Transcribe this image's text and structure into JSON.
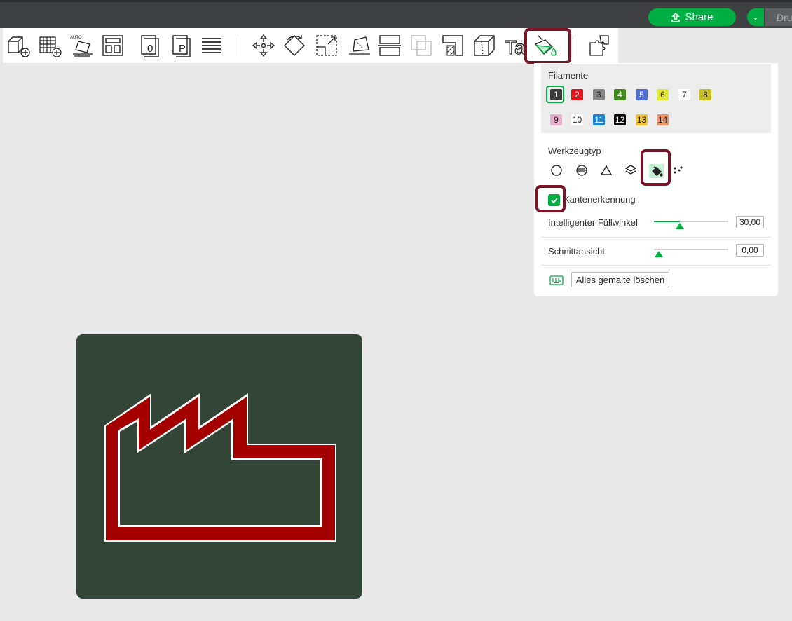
{
  "topbar": {
    "share_label": "Share",
    "print_label": "Dru"
  },
  "toolbar": {
    "tools": [
      {
        "name": "add-object-icon"
      },
      {
        "name": "add-plate-icon"
      },
      {
        "name": "auto-orient-icon",
        "label": "AUTO"
      },
      {
        "name": "arrange-icon"
      },
      {
        "name": "object-zero-icon",
        "label": "0"
      },
      {
        "name": "plate-p-icon",
        "label": "P"
      },
      {
        "name": "layers-list-icon"
      },
      {
        "name": "move-icon"
      },
      {
        "name": "rotate-icon"
      },
      {
        "name": "scale-icon"
      },
      {
        "name": "lay-on-face-icon"
      },
      {
        "name": "cut-icon"
      },
      {
        "name": "boolean-icon"
      },
      {
        "name": "support-paint-icon"
      },
      {
        "name": "seam-paint-icon"
      },
      {
        "name": "text-icon",
        "label": "Ta"
      },
      {
        "name": "color-paint-icon"
      },
      {
        "name": "assembly-icon"
      }
    ]
  },
  "panel": {
    "filament_title": "Filamente",
    "filaments": [
      {
        "label": "1",
        "color": "#3b3b3b",
        "text_color": "#ffffff"
      },
      {
        "label": "2",
        "color": "#e8141c",
        "text_color": "#ffffff"
      },
      {
        "label": "3",
        "color": "#858585",
        "text_color": "#222222"
      },
      {
        "label": "4",
        "color": "#3f8a1d",
        "text_color": "#ffffff"
      },
      {
        "label": "5",
        "color": "#4f6fd6",
        "text_color": "#ffffff"
      },
      {
        "label": "6",
        "color": "#e2ea2f",
        "text_color": "#222222"
      },
      {
        "label": "7",
        "color": "#ffffff",
        "text_color": "#222222"
      },
      {
        "label": "8",
        "color": "#c9be20",
        "text_color": "#222222"
      },
      {
        "label": "9",
        "color": "#e8b1cd",
        "text_color": "#222222"
      },
      {
        "label": "10",
        "color": "#ffffff",
        "text_color": "#222222"
      },
      {
        "label": "11",
        "color": "#1d84d6",
        "text_color": "#ffffff"
      },
      {
        "label": "12",
        "color": "#0a0a0a",
        "text_color": "#ffffff"
      },
      {
        "label": "13",
        "color": "#f5c331",
        "text_color": "#222222"
      },
      {
        "label": "14",
        "color": "#f29466",
        "text_color": "#222222"
      }
    ],
    "selected_filament": "1",
    "tool_type_title": "Werkzeugtyp",
    "tool_types": [
      {
        "name": "circle-tool-icon"
      },
      {
        "name": "sphere-tool-icon"
      },
      {
        "name": "triangle-tool-icon"
      },
      {
        "name": "height-range-tool-icon"
      },
      {
        "name": "fill-tool-icon"
      },
      {
        "name": "gap-fill-tool-icon"
      }
    ],
    "selected_tool": "fill-tool-icon",
    "edge_detection_label": "Kantenerkennung",
    "edge_detection_checked": true,
    "smart_fill_label": "Intelligenter Füllwinkel",
    "smart_fill_value": "30,00",
    "smart_fill_fraction": 0.35,
    "section_view_label": "Schnittansicht",
    "section_view_value": "0,00",
    "section_view_fraction": 0.0,
    "clear_button_label": "Alles gemalte löschen"
  },
  "colors": {
    "accent": "#00ae42",
    "highlight": "#7b1426",
    "plate": "#334536",
    "model_red": "#a40000"
  }
}
